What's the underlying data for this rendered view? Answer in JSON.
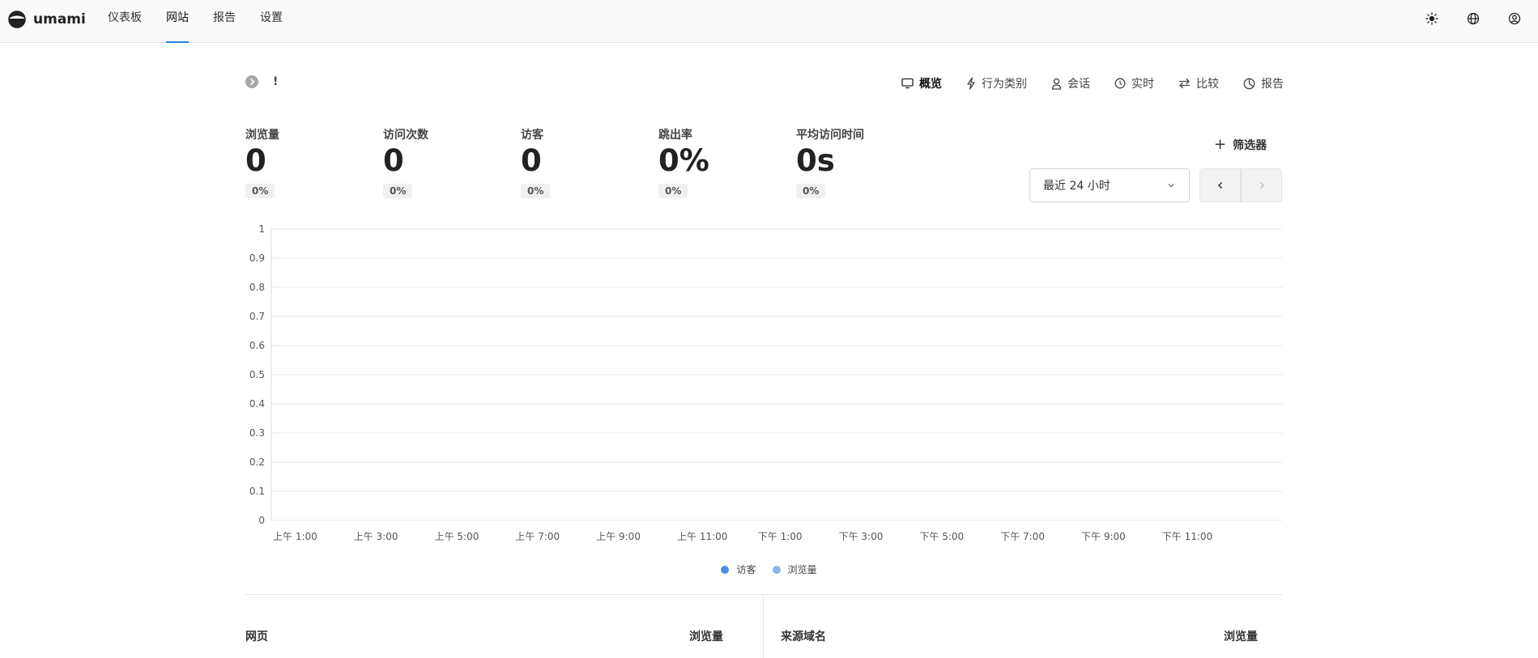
{
  "app": {
    "name": "umami"
  },
  "nav": {
    "items": [
      {
        "label": "仪表板",
        "active": false
      },
      {
        "label": "网站",
        "active": true
      },
      {
        "label": "报告",
        "active": false
      },
      {
        "label": "设置",
        "active": false
      }
    ]
  },
  "topbar": {
    "icons": [
      "sun-icon",
      "globe-icon",
      "user-icon"
    ]
  },
  "website": {
    "name": "!"
  },
  "view_tabs": [
    {
      "label": "概览",
      "icon": "monitor-icon",
      "active": true
    },
    {
      "label": "行为类别",
      "icon": "lightning-icon",
      "active": false
    },
    {
      "label": "会话",
      "icon": "user-icon",
      "active": false
    },
    {
      "label": "实时",
      "icon": "clock-icon",
      "active": false
    },
    {
      "label": "比较",
      "icon": "arrows-icon",
      "active": false
    },
    {
      "label": "报告",
      "icon": "pie-icon",
      "active": false
    }
  ],
  "metrics": [
    {
      "label": "浏览量",
      "value": "0",
      "change": "0%"
    },
    {
      "label": "访问次数",
      "value": "0",
      "change": "0%"
    },
    {
      "label": "访客",
      "value": "0",
      "change": "0%"
    },
    {
      "label": "跳出率",
      "value": "0%",
      "change": "0%"
    },
    {
      "label": "平均访问时间",
      "value": "0s",
      "change": "0%"
    }
  ],
  "filter": {
    "label": "筛选器"
  },
  "date_range": {
    "selected": "最近 24 小时"
  },
  "chart_data": {
    "type": "bar",
    "ylim": [
      0,
      1
    ],
    "yticks": [
      "1",
      "0.9",
      "0.8",
      "0.7",
      "0.6",
      "0.5",
      "0.4",
      "0.3",
      "0.2",
      "0.1",
      "0"
    ],
    "xticks": [
      "上午 1:00",
      "上午 3:00",
      "上午 5:00",
      "上午 7:00",
      "上午 9:00",
      "上午 11:00",
      "下午 1:00",
      "下午 3:00",
      "下午 5:00",
      "下午 7:00",
      "下午 9:00",
      "下午 11:00"
    ],
    "series": [
      {
        "name": "访客",
        "values": [],
        "color": "#4a90e2"
      },
      {
        "name": "浏览量",
        "values": [],
        "color": "#8ab6ee"
      }
    ],
    "grid": true,
    "legend": "bottom-center"
  },
  "tables": {
    "pages": {
      "title": "网页",
      "metric": "浏览量"
    },
    "referrers": {
      "title": "来源域名",
      "metric": "浏览量"
    }
  },
  "colors": {
    "accent": "#2680eb"
  }
}
